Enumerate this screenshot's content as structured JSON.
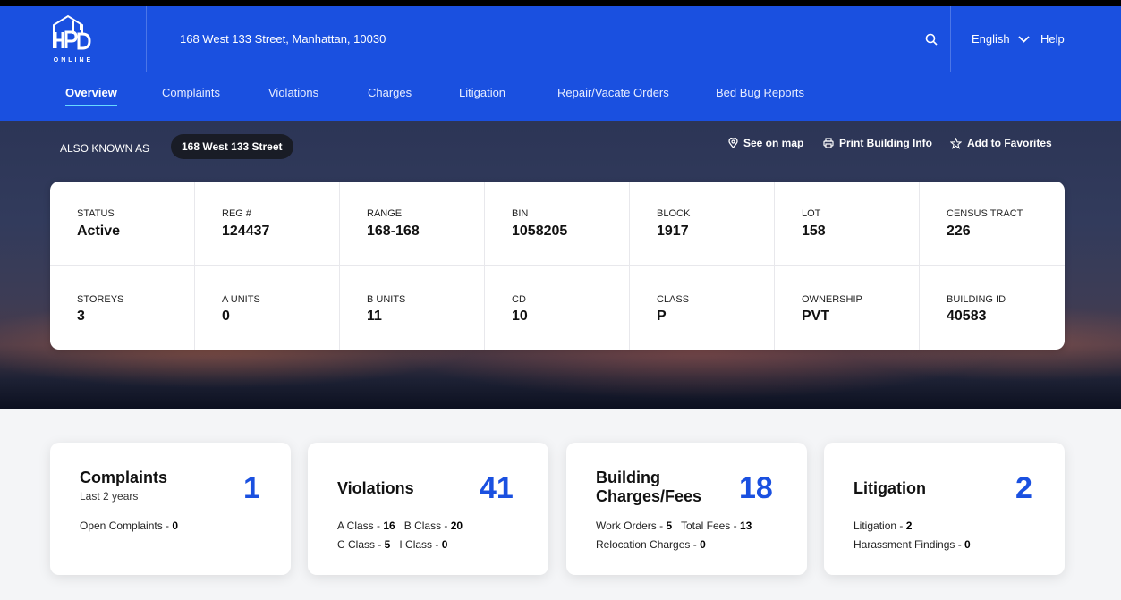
{
  "header": {
    "logo_text": "HPD ONLINE",
    "address": "168 West 133 Street, Manhattan, 10030",
    "language": "English",
    "help": "Help"
  },
  "nav": {
    "items": [
      "Overview",
      "Complaints",
      "Violations",
      "Charges",
      "Litigation",
      "Repair/Vacate Orders",
      "Bed Bug Reports"
    ],
    "active": "Overview"
  },
  "hero": {
    "aka_label": "ALSO KNOWN AS",
    "aka_value": "168 West 133 Street",
    "see_on_map": "See on map",
    "print_info": "Print Building Info",
    "add_favorites": "Add to Favorites"
  },
  "building_info": {
    "row1": [
      {
        "label": "STATUS",
        "value": "Active"
      },
      {
        "label": "REG #",
        "value": "124437"
      },
      {
        "label": "RANGE",
        "value": "168-168"
      },
      {
        "label": "BIN",
        "value": "1058205"
      },
      {
        "label": "BLOCK",
        "value": "1917"
      },
      {
        "label": "LOT",
        "value": "158"
      },
      {
        "label": "CENSUS TRACT",
        "value": "226"
      }
    ],
    "row2": [
      {
        "label": "STOREYS",
        "value": "3"
      },
      {
        "label": "A UNITS",
        "value": "0"
      },
      {
        "label": "B UNITS",
        "value": "11"
      },
      {
        "label": "CD",
        "value": "10"
      },
      {
        "label": "CLASS",
        "value": "P"
      },
      {
        "label": "OWNERSHIP",
        "value": "PVT"
      },
      {
        "label": "BUILDING ID",
        "value": "40583"
      }
    ]
  },
  "cards": {
    "complaints": {
      "title": "Complaints",
      "subtitle": "Last 2 years",
      "count": "1",
      "open_label": "Open Complaints - ",
      "open_value": "0"
    },
    "violations": {
      "title": "Violations",
      "count": "41",
      "a_label": "A Class - ",
      "a_value": "16",
      "b_label": "B Class - ",
      "b_value": "20",
      "c_label": "C Class - ",
      "c_value": "5",
      "i_label": "I Class - ",
      "i_value": "0"
    },
    "charges": {
      "title_line1": "Building",
      "title_line2": "Charges/Fees",
      "count": "18",
      "wo_label": "Work Orders - ",
      "wo_value": "5",
      "tf_label": "Total Fees - ",
      "tf_value": "13",
      "rc_label": "Relocation Charges - ",
      "rc_value": "0"
    },
    "litigation": {
      "title": "Litigation",
      "count": "2",
      "lit_label": "Litigation - ",
      "lit_value": "2",
      "hf_label": "Harassment Findings - ",
      "hf_value": "0"
    }
  },
  "colors": {
    "brand_blue": "#1a50e0",
    "nav_underline": "#68d9ff",
    "pill_bg": "#191c26"
  }
}
